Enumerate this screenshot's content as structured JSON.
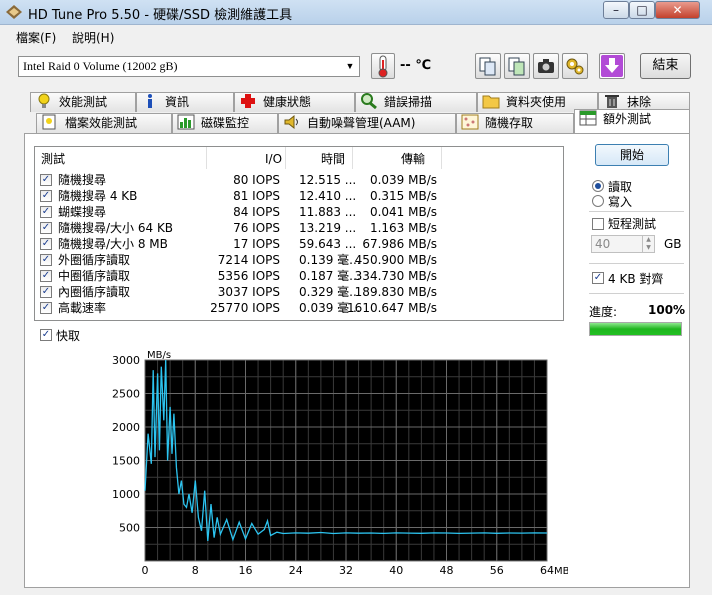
{
  "window": {
    "title": "HD Tune Pro 5.50 - 硬碟/SSD 檢測維護工具",
    "minimize": "–",
    "maximize": "□",
    "close": "✕"
  },
  "menu": [
    "檔案(F)",
    "說明(H)"
  ],
  "toolbar": {
    "drive": "Intel  Raid 0 Volume (12002 gB)",
    "temperature": "-- ℃",
    "exit_label": "結束"
  },
  "tabs_row1": [
    "效能測試",
    "資訊",
    "健康狀態",
    "錯誤掃描",
    "資料夾使用",
    "抹除"
  ],
  "tabs_row2": [
    "檔案效能測試",
    "磁碟監控",
    "自動噪聲管理(AAM)",
    "隨機存取",
    "額外測試"
  ],
  "table": {
    "columns": [
      "測試",
      "I/O",
      "時間",
      "傳輸"
    ],
    "rows": [
      {
        "name": "隨機搜尋",
        "io": "80 IOPS",
        "time": "12.515 ...",
        "transfer": "0.039 MB/s",
        "checked": true
      },
      {
        "name": "隨機搜尋 4 KB",
        "io": "81 IOPS",
        "time": "12.410 ...",
        "transfer": "0.315 MB/s",
        "checked": true
      },
      {
        "name": "蝴蝶搜尋",
        "io": "84 IOPS",
        "time": "11.883 ...",
        "transfer": "0.041 MB/s",
        "checked": true
      },
      {
        "name": "隨機搜尋/大小 64 KB",
        "io": "76 IOPS",
        "time": "13.219 ...",
        "transfer": "1.163 MB/s",
        "checked": true
      },
      {
        "name": "隨機搜尋/大小 8 MB",
        "io": "17 IOPS",
        "time": "59.643 ...",
        "transfer": "67.986 MB/s",
        "checked": true
      },
      {
        "name": "外圈循序讀取",
        "io": "7214 IOPS",
        "time": "0.139 毫...",
        "transfer": "450.900 MB/s",
        "checked": true
      },
      {
        "name": "中圈循序讀取",
        "io": "5356 IOPS",
        "time": "0.187 毫...",
        "transfer": "334.730 MB/s",
        "checked": true
      },
      {
        "name": "內圈循序讀取",
        "io": "3037 IOPS",
        "time": "0.329 毫...",
        "transfer": "189.830 MB/s",
        "checked": true
      },
      {
        "name": "高載速率",
        "io": "25770 IOPS",
        "time": "0.039 毫...",
        "transfer": "1610.647 MB/s",
        "checked": true
      }
    ]
  },
  "cache_label": "快取",
  "side": {
    "start_label": "開始",
    "read_label": "讀取",
    "write_label": "寫入",
    "short_test_label": "短程測試",
    "short_value": "40",
    "short_unit": "GB",
    "align_label": "4 KB 對齊",
    "progress_label": "進度:",
    "progress_value": "100%",
    "progress_fraction": 1.0
  },
  "chart_data": {
    "type": "line",
    "ylabel": "MB/s",
    "xlabel": "MB",
    "xlim": [
      0,
      64
    ],
    "ylim": [
      0,
      3000
    ],
    "xticks": [
      0,
      8,
      16,
      24,
      32,
      40,
      48,
      56,
      64
    ],
    "yticks": [
      500,
      1000,
      1500,
      2000,
      2500,
      3000
    ],
    "grid": true,
    "line_color": "#2cc4f0",
    "background": "#000000",
    "x": [
      0,
      0.5,
      1,
      1.3,
      1.6,
      2,
      2.3,
      2.6,
      3,
      3.3,
      3.6,
      4,
      4.3,
      4.6,
      5,
      5.4,
      5.8,
      6.2,
      6.6,
      7,
      7.5,
      8,
      8.5,
      9,
      9.5,
      10,
      10.5,
      11,
      11.5,
      12,
      13,
      14,
      15,
      16,
      17,
      18,
      19,
      19.5,
      20,
      21,
      22,
      24,
      26,
      28,
      30,
      32,
      34,
      36,
      38,
      40,
      42,
      44,
      46,
      48,
      50,
      52,
      54,
      56,
      58,
      60,
      62,
      64
    ],
    "y": [
      1050,
      1900,
      1450,
      2850,
      1550,
      2800,
      1650,
      2900,
      2100,
      3000,
      1500,
      2300,
      1600,
      2200,
      1400,
      1000,
      1200,
      850,
      800,
      1000,
      720,
      1200,
      650,
      450,
      1050,
      300,
      850,
      350,
      650,
      400,
      620,
      320,
      580,
      330,
      560,
      400,
      470,
      600,
      380,
      430,
      410,
      420,
      415,
      425,
      410,
      420,
      415,
      418,
      412,
      420,
      416,
      414,
      420,
      418,
      412,
      416,
      420,
      414,
      418,
      416,
      420,
      418
    ]
  }
}
